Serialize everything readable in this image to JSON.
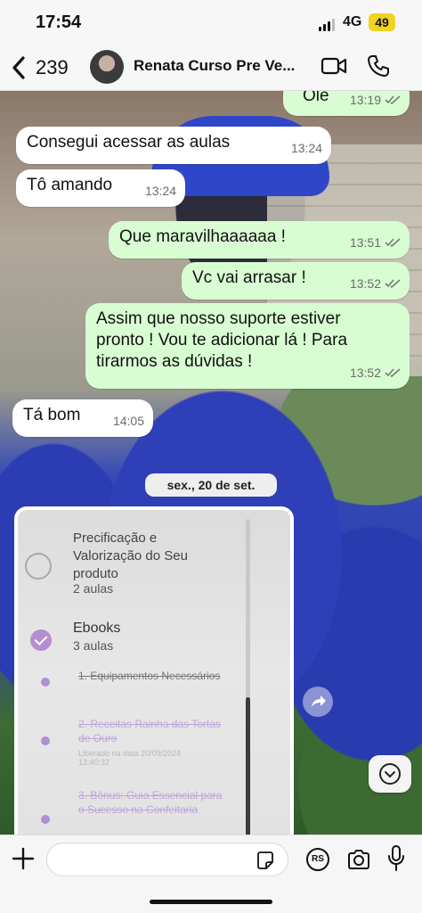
{
  "status_bar": {
    "time": "17:54",
    "network": "4G",
    "battery": "49"
  },
  "header": {
    "back_count": "239",
    "contact_name": "Renata Curso Pre Ve..."
  },
  "messages": [
    {
      "direction": "out",
      "text": "Ole",
      "time": "13:19",
      "read": true
    },
    {
      "direction": "in",
      "text": "Consegui acessar as aulas",
      "time": "13:24"
    },
    {
      "direction": "in",
      "text": "Tô amando",
      "time": "13:24"
    },
    {
      "direction": "out",
      "text": "Que maravilhaaaaaa !",
      "time": "13:51",
      "read": true
    },
    {
      "direction": "out",
      "text": "Vc vai arrasar !",
      "time": "13:52",
      "read": true
    },
    {
      "direction": "out",
      "text": "Assim que nosso suporte estiver pronto ! Vou te adicionar lá ! Para tirarmos as dúvidas !",
      "time": "13:52",
      "read": true
    },
    {
      "direction": "in",
      "text": "Tá bom",
      "time": "14:05"
    }
  ],
  "date_divider": "sex., 20 de set.",
  "image_message": {
    "module1_title": "Precificação e Valorização do Seu produto",
    "module1_sub": "2 aulas",
    "module2_title": "Ebooks",
    "module2_sub": "3 aulas",
    "lesson1": "1. Equipamentos Necessários",
    "lesson2": "2. Receitas Rainha das Tortas de Ouro",
    "lesson2_sub": "Liberado na data 20/09/2024 13:40:32",
    "lesson3": "3. Bônus: Guia Essencial para o Sucesso na Confeitaria"
  },
  "composer": {
    "placeholder": "",
    "rs_label": "RS"
  },
  "icons": [
    "back-chevron-icon",
    "video-call-icon",
    "phone-call-icon",
    "read-receipt-icon",
    "share-forward-icon",
    "scroll-down-icon",
    "plus-icon",
    "sticker-icon",
    "camera-icon",
    "microphone-icon"
  ]
}
